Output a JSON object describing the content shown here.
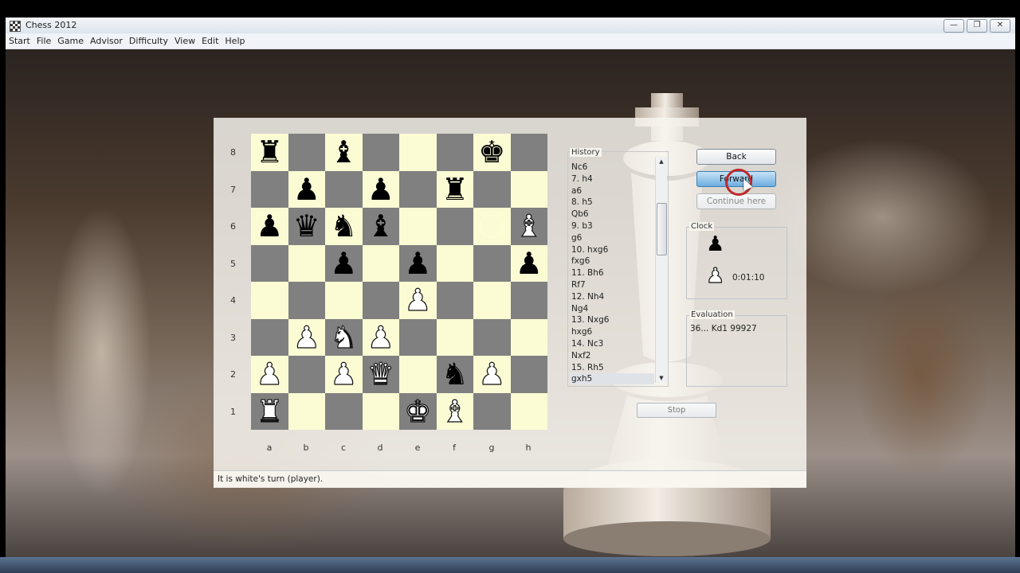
{
  "app": {
    "title": "Chess 2012"
  },
  "window_buttons": {
    "minimize": "—",
    "restore": "❐",
    "close": "✕"
  },
  "menu": [
    "Start",
    "File",
    "Game",
    "Advisor",
    "Difficulty",
    "View",
    "Edit",
    "Help"
  ],
  "board": {
    "ranks": [
      "8",
      "7",
      "6",
      "5",
      "4",
      "3",
      "2",
      "1"
    ],
    "files": [
      "a",
      "b",
      "c",
      "d",
      "e",
      "f",
      "g",
      "h"
    ],
    "rows": [
      [
        "br",
        "",
        "bb",
        "",
        "",
        "",
        "bk",
        ""
      ],
      [
        "",
        "bp",
        "",
        "bp",
        "",
        "br",
        "",
        ""
      ],
      [
        "bp",
        "bq",
        "bn",
        "bb",
        "",
        "",
        "",
        "wb"
      ],
      [
        "",
        "",
        "bp",
        "",
        "bp",
        "",
        "",
        "bp"
      ],
      [
        "",
        "",
        "",
        "",
        "wp",
        "",
        "",
        ""
      ],
      [
        "",
        "wp",
        "wn",
        "wp",
        "",
        "",
        "",
        ""
      ],
      [
        "wp",
        "",
        "wp",
        "wq",
        "",
        "bn",
        "wp",
        ""
      ],
      [
        "wr",
        "",
        "",
        "",
        "wk",
        "wb",
        "",
        ""
      ]
    ],
    "glyphs": {
      "wk": "♚",
      "wq": "♛",
      "wr": "♜",
      "wb": "♝",
      "wn": "♞",
      "wp": "♟",
      "bk": "♚",
      "bq": "♛",
      "br": "♜",
      "bb": "♝",
      "bn": "♞",
      "bp": "♟"
    },
    "light_color": "#fbfbd4",
    "dark_color": "#808080"
  },
  "history": {
    "title": "History",
    "moves": [
      "Nc6",
      "7. h4",
      "a6",
      "8. h5",
      "Qb6",
      "9. b3",
      "g6",
      "10. hxg6",
      "fxg6",
      "11. Bh6",
      "Rf7",
      "12. Nh4",
      "Ng4",
      "13. Nxg6",
      "hxg6",
      "14. Nc3",
      "Nxf2",
      "15. Rh5",
      "gxh5"
    ]
  },
  "buttons": {
    "back": "Back",
    "forward": "Forward",
    "continue_here": "Continue here",
    "stop": "Stop"
  },
  "clock": {
    "title": "Clock",
    "black_icon": "♟",
    "white_icon": "♟",
    "white_time": "0:01:10"
  },
  "evaluation": {
    "title": "Evaluation",
    "text": "36... Kd1 99927"
  },
  "status": {
    "text": "It is white's turn (player)."
  }
}
